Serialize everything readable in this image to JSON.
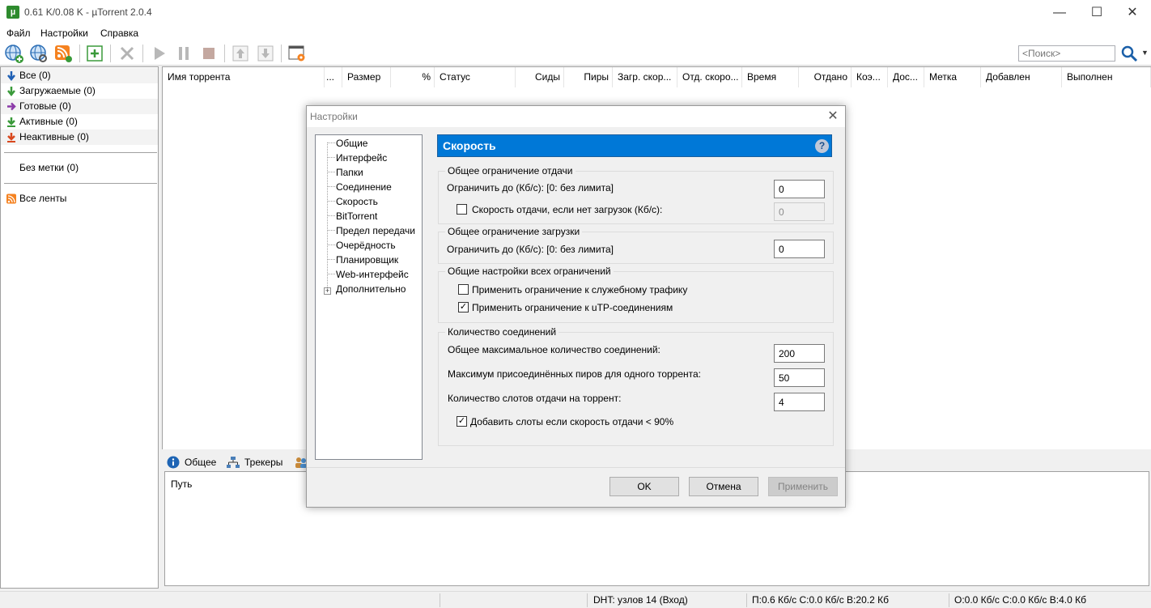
{
  "window": {
    "title": "0.61 K/0.08 K  -  µTorrent 2.0.4",
    "app_icon_letter": "µ",
    "minimize": "—",
    "maximize": "☐",
    "close": "✕"
  },
  "menu": [
    "Файл",
    "Настройки",
    "Справка"
  ],
  "toolbar": {
    "search_placeholder": "<Поиск>",
    "search_dropdown": "▼"
  },
  "sidebar": {
    "items": [
      {
        "label": "Все (0)"
      },
      {
        "label": "Загружаемые (0)"
      },
      {
        "label": "Готовые (0)"
      },
      {
        "label": "Активные (0)"
      },
      {
        "label": "Неактивные (0)"
      }
    ],
    "labels_item": "Без метки (0)",
    "feeds_item": "Все ленты"
  },
  "torrent_list": {
    "columns": [
      "Имя торрента",
      "...",
      "Размер",
      "%",
      "Статус",
      "Сиды",
      "Пиры",
      "Загр. скор...",
      "Отд. скоро...",
      "Время",
      "Отдано",
      "Коэ...",
      "Дос...",
      "Метка",
      "Добавлен",
      "Выполнен"
    ]
  },
  "bottom_tabs": [
    "Общее",
    "Трекеры"
  ],
  "details": {
    "path_label": "Путь"
  },
  "statusbar": {
    "dht": "DHT: узлов 14 (Вход)",
    "download": "П:0.6 Кб/с С:0.0 Кб/с В:20.2 Кб",
    "upload": "О:0.0 Кб/с С:0.0 Кб/с В:4.0 Кб"
  },
  "dialog": {
    "title": "Настройки",
    "close": "✕",
    "tree": [
      "Общие",
      "Интерфейс",
      "Папки",
      "Соединение",
      "Скорость",
      "BitTorrent",
      "Предел передачи",
      "Очерёдность",
      "Планировщик",
      "Web-интерфейс",
      "Дополнительно"
    ],
    "tree_expander": "+",
    "panel_title": "Скорость",
    "help": "?",
    "upload_group": {
      "label": "Общее ограничение отдачи",
      "limit_label": "Ограничить до (Кб/с): [0: без лимита]",
      "limit_value": "0",
      "alt_label": "Скорость отдачи, если нет загрузок (Кб/с):",
      "alt_checked": false,
      "alt_value": "0"
    },
    "download_group": {
      "label": "Общее ограничение загрузки",
      "limit_label": "Ограничить до (Кб/с): [0: без лимита]",
      "limit_value": "0"
    },
    "global_group": {
      "label": "Общие настройки всех ограничений",
      "overhead_label": "Применить ограничение к служебному трафику",
      "overhead_checked": false,
      "utp_label": "Применить ограничение к uTP-соединениям",
      "utp_checked": true
    },
    "connections_group": {
      "label": "Количество соединений",
      "max_conn_label": "Общее максимальное количество соединений:",
      "max_conn_value": "200",
      "max_peers_label": "Максимум присоединённых пиров для одного торрента:",
      "max_peers_value": "50",
      "slots_label": "Количество слотов отдачи на торрент:",
      "slots_value": "4",
      "extra_slots_label": "Добавить слоты если скорость отдачи < 90%",
      "extra_slots_checked": true
    },
    "buttons": {
      "ok": "OK",
      "cancel": "Отмена",
      "apply": "Применить"
    }
  }
}
